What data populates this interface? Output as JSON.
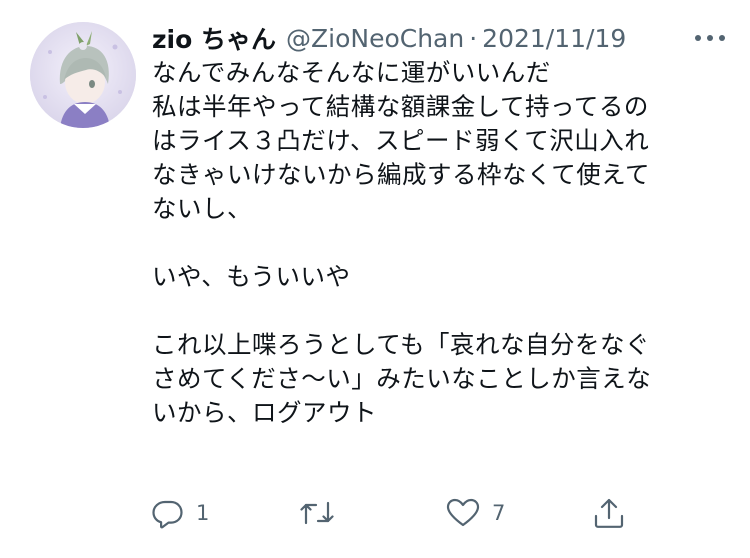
{
  "tweet": {
    "display_name": "zio ちゃん",
    "handle": "@ZioNeoChan",
    "separator": "·",
    "date": "2021/11/19",
    "lines": [
      "なんでみんなそんなに運がいいんだ",
      "私は半年やって結構な額課金して持ってるの",
      "はライス３凸だけ、スピード弱くて沢山入れ",
      "なきゃいけないから編成する枠なくて使えて",
      "ないし、",
      "",
      "いや、もういいや",
      "",
      "これ以上喋ろうとしても「哀れな自分をなぐ",
      "さめてくださ〜い」みたいなことしか言えな",
      "いから、ログアウト"
    ]
  },
  "actions": {
    "reply_icon": "reply-icon",
    "reply_count": "1",
    "retweet_icon": "retweet-icon",
    "like_icon": "heart-icon",
    "like_count": "7",
    "share_icon": "share-icon"
  },
  "colors": {
    "text": "#0f1419",
    "secondary": "#536471",
    "background": "#ffffff"
  }
}
